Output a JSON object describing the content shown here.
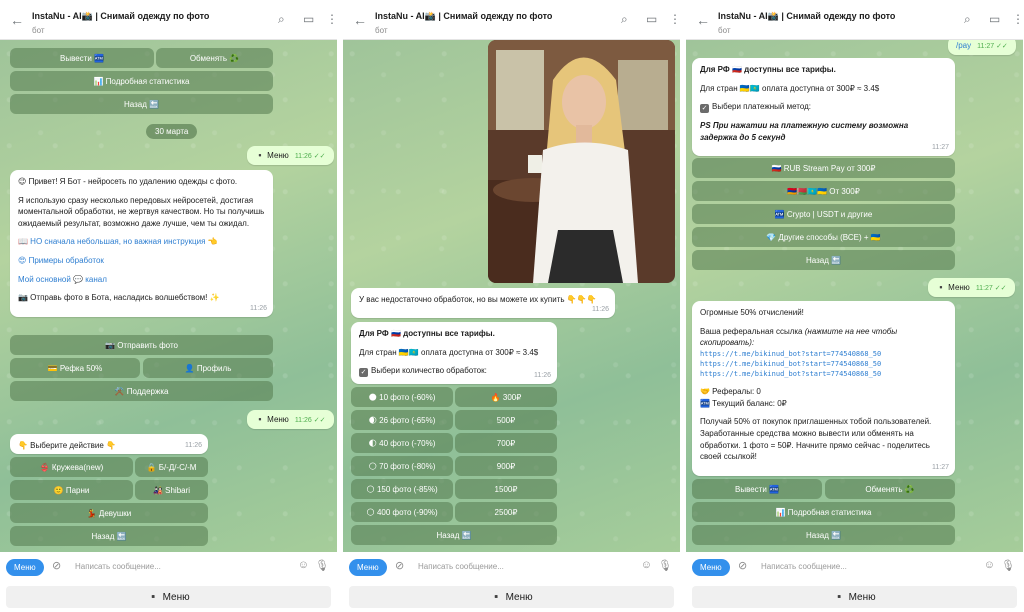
{
  "header": {
    "title": "InstaNu - AI📸 | Снимай одежду по фото",
    "subtitle": "бот"
  },
  "input": {
    "menu_label": "Меню",
    "placeholder": "Написать сообщение..."
  },
  "reply_keyboard": {
    "menu_label": "▪️ Меню"
  },
  "panel1": {
    "top_buttons": {
      "withdraw": "Вывести 🏧",
      "exchange": "Обменять ♻️",
      "stats": "📊 Подробная статистика",
      "back": "Назад 🔙"
    },
    "date_badge": "30 марта",
    "out1": {
      "text": "▪️ Меню",
      "time": "11:26 ✓✓"
    },
    "welcome": {
      "lines": [
        "😉 Привет! Я Бот - нейросеть по удалению одежды с фото.",
        "Я использую сразу несколько передовых нейросетей, достигая моментальной обработки, не жертвуя качеством. Но ты получишь ожидаемый результат, возможно даже лучше, чем ты ожидал.",
        "📖 НО сначала небольшая, но важная инструкция 👈",
        "😍 Примеры обработок",
        "Мой основной 💬 канал",
        "📷 Отправь фото в Бота, насладись волшебством! ✨"
      ],
      "time": "11:26"
    },
    "buttons": {
      "send_photo": "📷 Отправить фото",
      "referral": "💳 Рефка 50%",
      "profile": "👤 Профиль",
      "support": "⚒️ Поддержка"
    },
    "out2": {
      "text": "▪️ Меню",
      "time": "11:26 ✓✓"
    },
    "choose": {
      "text": "👇 Выберите действие 👇",
      "time": "11:26"
    },
    "actions": {
      "lace": "👙 Кружева(new)",
      "bdsm": "🔒 Б/-Д/-С/-М",
      "guys": "🙂 Парни",
      "shibari": "🎎 Shibari",
      "girls": "💃 Девушки",
      "back": "Назад 🔙"
    }
  },
  "panel2": {
    "not_enough": {
      "text": "У вас недостаточно обработок, но вы можете их купить 👇👇👇",
      "time": "11:26"
    },
    "tariffs": {
      "line1": "Для РФ 🇷🇺 доступны все тарифы.",
      "line2": "Для стран 🇺🇦🇰🇿 оплата доступна от 300₽ ≈ 3.4$",
      "line3": "Выбери количество обработок:",
      "time": "11:26"
    },
    "rows": [
      {
        "left": "🌑 10 фото (-60%)",
        "right": "🔥 300₽"
      },
      {
        "left": "🌒 26 фото (-65%)",
        "right": "500₽"
      },
      {
        "left": "🌓 40 фото (-70%)",
        "right": "700₽"
      },
      {
        "left": "🌕 70 фото (-80%)",
        "right": "900₽"
      },
      {
        "left": "🌕 150 фото (-85%)",
        "right": "1500₽"
      },
      {
        "left": "🌕 400 фото (-90%)",
        "right": "2500₽"
      }
    ],
    "back": "Назад 🔙"
  },
  "panel3": {
    "top_out": {
      "text": "/pay",
      "time": "11:27 ✓✓"
    },
    "tariffs": {
      "line1": "Для РФ 🇷🇺 доступны все тарифы.",
      "line2": "Для стран 🇺🇦🇰🇿 оплата доступна от 300₽ ≈ 3.4$",
      "line3": "Выбери платежный метод:",
      "note": "PS При нажатии на платежную систему возможна задержка до 5 секунд",
      "time": "11:27"
    },
    "pay_buttons": {
      "rub": "🇷🇺 RUB Stream Pay от 300₽",
      "cis": "🇦🇲🇧🇾🇰🇿🇺🇦 От 300₽",
      "crypto": "🏧 Crypto | USDT и другие",
      "other": "💎 Другие способы (ВСЕ) + 🇺🇦",
      "back": "Назад 🔙"
    },
    "out_menu": {
      "text": "▪️ Меню",
      "time": "11:27 ✓✓"
    },
    "referral": {
      "headline": "Огромные 50% отчислений!",
      "link_label": "Ваша реферальная ссылка",
      "link_hint": "(нажмите на нее чтобы скопировать):",
      "links": [
        "https://t.me/bikinud_bot?start=774540868_50",
        "https://t.me/bikinud_bot?start=774540868_50",
        "https://t.me/bikinud_bot?start=774540868_50"
      ],
      "referrals": "🤝 Рефералы: 0",
      "balance": "🏧 Текущий баланс: 0₽",
      "info": "Получай 50% от покупок приглашенных тобой пользователей. Заработанные средства можно вывести или обменять на обработки. 1 фото = 50₽. Начните прямо сейчас - поделитесь своей ссылкой!",
      "time": "11:27"
    },
    "bottom_buttons": {
      "withdraw": "Вывести 🏧",
      "exchange": "Обменять ♻️",
      "stats": "📊 Подробная статистика",
      "back": "Назад 🔙"
    }
  }
}
